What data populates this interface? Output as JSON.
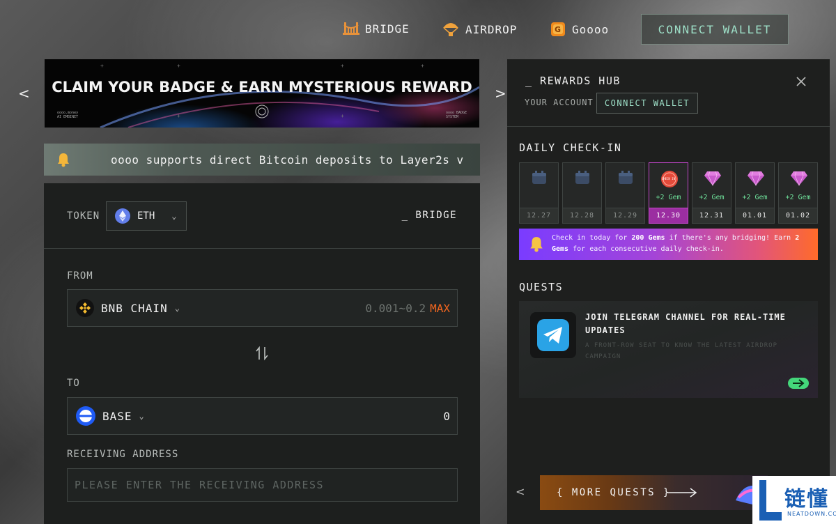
{
  "nav": {
    "bridge": "BRIDGE",
    "airdrop": "AIRDROP",
    "gooo": "Goooo",
    "connect_wallet": "CONNECT WALLET"
  },
  "banner": {
    "title": "CLAIM YOUR BADGE & EARN MYSTERIOUS REWARD",
    "left_small_1": "oooo.money",
    "left_small_2": "AI EMBINET",
    "right_small_1": "oooo BADGE",
    "right_small_2": "SYSTEM",
    "prev": "<",
    "next": ">"
  },
  "announcement": {
    "text": "oooo supports direct Bitcoin deposits to Layer2s v"
  },
  "bridge": {
    "token_label": "TOKEN",
    "token_value": "ETH",
    "tag": "_ BRIDGE",
    "from_label": "FROM",
    "from_chain": "BNB CHAIN",
    "range": "0.001~0.2",
    "max": "MAX",
    "to_label": "TO",
    "to_chain": "BASE",
    "to_amount": "0",
    "receiving_label": "RECEIVING ADDRESS",
    "receiving_placeholder": "PLEASE ENTER THE RECEIVING ADDRESS"
  },
  "hub": {
    "title": "_ REWARDS HUB",
    "account_label": "YOUR ACCOUNT",
    "connect_wallet": "CONNECT WALLET",
    "checkin_title": "DAILY CHECK-IN",
    "days": [
      {
        "date": "12.27",
        "label": ""
      },
      {
        "date": "12.28",
        "label": ""
      },
      {
        "date": "12.29",
        "label": ""
      },
      {
        "date": "12.30",
        "label": "+2 Gem"
      },
      {
        "date": "12.31",
        "label": "+2 Gem"
      },
      {
        "date": "01.01",
        "label": "+2 Gem"
      },
      {
        "date": "01.02",
        "label": "+2 Gem"
      }
    ],
    "today_stamp": "CHECK IN",
    "promo_1": "Check in today for ",
    "promo_gems": "200 Gems",
    "promo_2": " if there's any bridging! Earn ",
    "promo_gems2": "2 Gems",
    "promo_3": " for each consecutive daily check-in.",
    "quests_title": "QUESTS",
    "quest_title": "JOIN TELEGRAM CHANNEL FOR REAL-TIME UPDATES",
    "quest_desc": "A FRONT-ROW SEAT TO KNOW THE LATEST AIRDROP CAMPAIGN",
    "more_quests": "{ MORE QUESTS }",
    "prev": "<"
  },
  "watermark": {
    "cn": "链懂",
    "en": "NEATDOWN.COM"
  },
  "colors": {
    "accent_green": "#9ee0c8",
    "max_orange": "#f2661f",
    "today_purple": "#9b2ea1",
    "gem_green": "#6ee09a"
  }
}
